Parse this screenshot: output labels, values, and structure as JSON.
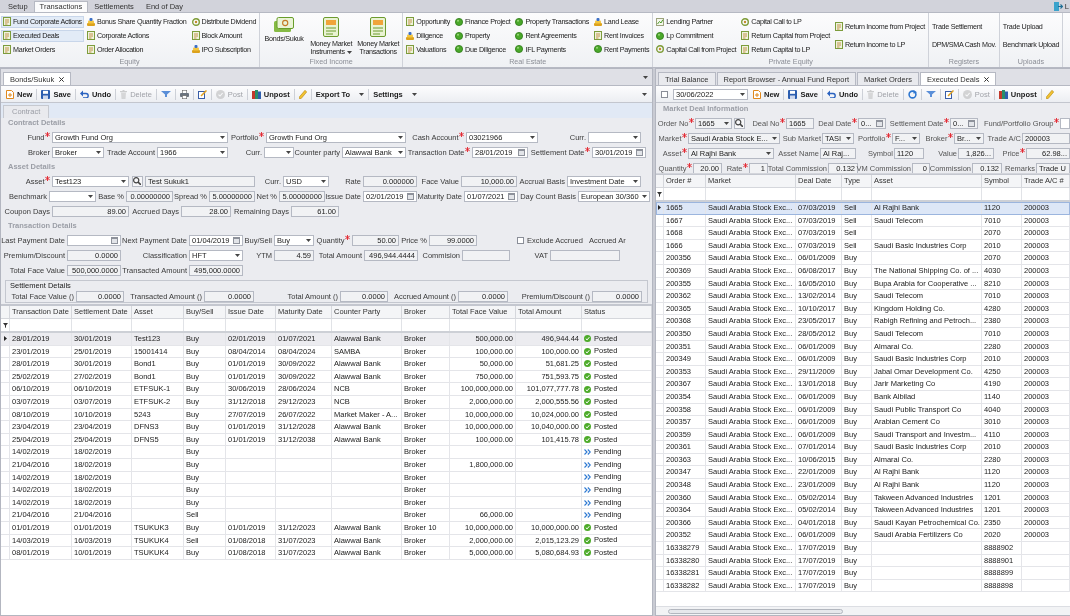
{
  "top_tabs": [
    {
      "label": "Setup",
      "selected": false
    },
    {
      "label": "Transactions",
      "selected": true
    },
    {
      "label": "Settlements",
      "selected": false
    },
    {
      "label": "End of Day",
      "selected": false
    }
  ],
  "logout": {
    "label": "L"
  },
  "ribbon": {
    "groups": [
      {
        "title": "Equity",
        "kind": "small",
        "columns": [
          [
            {
              "label": "Fund Corporate Actions",
              "kind": "doc",
              "highlighted": true
            },
            {
              "label": "Executed Deals",
              "kind": "doc",
              "highlighted": true
            },
            {
              "label": "Market Orders",
              "kind": "doc",
              "highlighted": false
            }
          ],
          [
            {
              "label": "Bonus Share Quantity Fraction",
              "kind": "coin",
              "highlighted": false
            },
            {
              "label": "Corporate Actions",
              "kind": "doc",
              "highlighted": false
            },
            {
              "label": "Order Allocation",
              "kind": "doc",
              "highlighted": false
            }
          ],
          [
            {
              "label": "Distribute Dividend",
              "kind": "ring",
              "highlighted": false
            },
            {
              "label": "Block Amount",
              "kind": "doc",
              "highlighted": false
            },
            {
              "label": "IPO Subscription",
              "kind": "coin",
              "highlighted": false
            }
          ]
        ]
      },
      {
        "title": "Fixed Income",
        "kind": "large",
        "buttons": [
          {
            "label": "Bonds/Sukuk",
            "kind": "cash",
            "dropdown": false
          },
          {
            "label": "Money Market Instruments",
            "kind": "doc",
            "dropdown": true
          },
          {
            "label": "Money Market Transactions",
            "kind": "doc",
            "dropdown": false
          }
        ]
      },
      {
        "title": "Real Estate",
        "kind": "small",
        "columns": [
          [
            {
              "label": "Opportunity",
              "kind": "doc",
              "highlighted": false
            },
            {
              "label": "Diligence",
              "kind": "coin",
              "highlighted": false
            },
            {
              "label": "Valuations",
              "kind": "doc",
              "highlighted": false
            }
          ],
          [
            {
              "label": "Finance Project",
              "kind": "dot",
              "highlighted": false
            },
            {
              "label": "Property",
              "kind": "dot",
              "highlighted": false
            },
            {
              "label": "Due Diligence",
              "kind": "dot",
              "highlighted": false
            }
          ],
          [
            {
              "label": "Property Transactions",
              "kind": "dot",
              "highlighted": false
            },
            {
              "label": "Rent Agreements",
              "kind": "dot",
              "highlighted": false
            },
            {
              "label": "IFL Payments",
              "kind": "dot",
              "highlighted": false
            }
          ],
          [
            {
              "label": "Land Lease",
              "kind": "coin",
              "highlighted": false
            },
            {
              "label": "Rent Invoices",
              "kind": "doc",
              "highlighted": false
            },
            {
              "label": "Rent Payments",
              "kind": "dot",
              "highlighted": false
            }
          ]
        ]
      },
      {
        "title": "Private Equity",
        "kind": "small",
        "columns": [
          [
            {
              "label": "Lending Partner",
              "kind": "chart",
              "highlighted": false
            },
            {
              "label": "Lp Commitment",
              "kind": "dot",
              "highlighted": false
            },
            {
              "label": "Capital Call from Project",
              "kind": "ring",
              "highlighted": false
            }
          ],
          [
            {
              "label": "Capital Call to LP",
              "kind": "ring",
              "highlighted": false
            },
            {
              "label": "Return Capital from Project",
              "kind": "doc",
              "highlighted": false
            },
            {
              "label": "Return Capital to LP",
              "kind": "doc",
              "highlighted": false
            }
          ],
          [
            {
              "label": "Return Income from Project",
              "kind": "doc",
              "highlighted": false
            },
            {
              "label": "Return Income to LP",
              "kind": "doc",
              "highlighted": false
            }
          ]
        ]
      },
      {
        "title": "Registers",
        "kind": "small",
        "columns": [
          [
            {
              "label": "Trade Settlement",
              "kind": "plain",
              "highlighted": false
            },
            {
              "label": "DPM/SMA Cash Mov.",
              "kind": "plain",
              "highlighted": false
            }
          ]
        ]
      },
      {
        "title": "Uploads",
        "kind": "small",
        "columns": [
          [
            {
              "label": "Trade Upload",
              "kind": "plain",
              "highlighted": false
            },
            {
              "label": "Benchmark Upload",
              "kind": "plain",
              "highlighted": false
            }
          ]
        ]
      }
    ]
  },
  "left_pane": {
    "doc_tabs": [
      {
        "label": "Bonds/Sukuk",
        "selected": true,
        "closable": true
      }
    ],
    "toolbar": [
      {
        "kind": "new",
        "label": "New",
        "disabled": false,
        "dropdown": false
      },
      {
        "kind": "save",
        "label": "Save",
        "disabled": false,
        "dropdown": false
      },
      {
        "kind": "undo",
        "label": "Undo",
        "disabled": false,
        "dropdown": false
      },
      {
        "kind": "delete",
        "label": "Delete",
        "disabled": true,
        "dropdown": false
      },
      {
        "kind": "filter",
        "disabled": false,
        "dropdown": false
      },
      {
        "kind": "print",
        "disabled": false,
        "dropdown": false
      },
      {
        "kind": "edit",
        "disabled": false,
        "dropdown": false
      },
      {
        "kind": "post",
        "label": "Post",
        "disabled": true,
        "dropdown": false
      },
      {
        "kind": "unpost",
        "label": "Unpost",
        "disabled": false,
        "dropdown": false
      },
      {
        "kind": "pencil",
        "disabled": false,
        "dropdown": false
      },
      {
        "kind": "export",
        "label": "Export To",
        "disabled": false,
        "dropdown": true
      },
      {
        "kind": "settings",
        "label": "Settings",
        "disabled": false,
        "dropdown": true
      }
    ],
    "sub_tabs": [
      {
        "label": "Contract",
        "selected": true
      }
    ],
    "sections": [
      {
        "title": "Contract Details",
        "fields": [
          {
            "label": "Fund",
            "required": true,
            "kind": "combo",
            "value": "Growth Fund Org",
            "readonly": false
          },
          {
            "label": "Portfolio",
            "required": true,
            "kind": "combo",
            "value": "Growth Fund Org",
            "readonly": false
          },
          {
            "label": "Cash Account",
            "required": true,
            "kind": "combo",
            "value": "03021966",
            "readonly": false
          },
          {
            "label": "Curr.",
            "required": false,
            "kind": "combo",
            "readonly": false
          },
          {
            "label": "Broker",
            "required": false,
            "kind": "combo",
            "value": "Broker",
            "readonly": false
          },
          {
            "label": "Trade Account",
            "required": false,
            "kind": "combo",
            "value": "1966",
            "readonly": false
          },
          {
            "label": "Curr.",
            "required": false,
            "kind": "combo",
            "readonly": false
          },
          {
            "label": "Counter party",
            "required": false,
            "kind": "combo",
            "value": "Alawwal Bank",
            "readonly": false
          },
          {
            "label": "Transaction Date",
            "required": true,
            "kind": "date",
            "value": "28/01/2019",
            "readonly": false
          },
          {
            "label": "Settlement Date",
            "required": true,
            "kind": "date",
            "value": "30/01/2019",
            "readonly": false
          }
        ]
      },
      {
        "title": "Asset Details",
        "fields": [
          {
            "label": "Asset",
            "required": true,
            "kind": "combo",
            "value": "Test123",
            "readonly": false
          },
          {
            "kind": "search"
          },
          {
            "kind": "text",
            "value": "Test Sukuk1",
            "readonly": true
          },
          {
            "label": "Curr.",
            "required": false,
            "kind": "combo",
            "value": "USD",
            "readonly": false
          },
          {
            "label": "Rate",
            "required": false,
            "kind": "number",
            "value": "0.000000",
            "readonly": true
          },
          {
            "label": "Face Value",
            "required": false,
            "kind": "number",
            "value": "10,000.00",
            "readonly": true
          },
          {
            "label": "Accrual Basis",
            "required": false,
            "kind": "combo",
            "value": "Investment Date",
            "readonly": false
          },
          {
            "label": "Benchmark",
            "required": false,
            "kind": "combo",
            "readonly": false
          },
          {
            "label": "Base %",
            "required": false,
            "kind": "number",
            "value": "0.00000000",
            "readonly": true
          },
          {
            "label": "Spread %",
            "required": false,
            "kind": "number",
            "value": "5.00000000",
            "readonly": true
          },
          {
            "label": "Net %",
            "required": false,
            "kind": "number",
            "value": "5.00000000",
            "readonly": true
          },
          {
            "label": "Issue Date",
            "required": false,
            "kind": "date",
            "value": "02/01/2019",
            "readonly": false
          },
          {
            "label": "Maturity Date",
            "required": false,
            "kind": "date",
            "value": "01/07/2021",
            "readonly": false
          },
          {
            "label": "Day Count Basis",
            "required": false,
            "kind": "combo",
            "value": "European 30/360",
            "readonly": false
          },
          {
            "label": "Coupon Days",
            "required": false,
            "kind": "number",
            "value": "89.00",
            "readonly": true
          },
          {
            "label": "Accrued Days",
            "required": false,
            "kind": "number",
            "value": "28.00",
            "readonly": true
          },
          {
            "label": "Remaining Days",
            "required": false,
            "kind": "number",
            "value": "61.00",
            "readonly": true
          }
        ]
      },
      {
        "title": "Transaction Details",
        "fields": [
          {
            "label": "Last Payment Date",
            "required": false,
            "kind": "date",
            "readonly": false
          },
          {
            "label": "Next Payment Date",
            "required": false,
            "kind": "date",
            "value": "01/04/2019",
            "readonly": false
          },
          {
            "label": "Buy/Sell",
            "required": false,
            "kind": "combo",
            "value": "Buy",
            "readonly": false
          },
          {
            "label": "Quantity",
            "required": true,
            "kind": "number",
            "value": "50.00",
            "readonly": true
          },
          {
            "label": "Price %",
            "required": false,
            "kind": "number",
            "value": "99.0000",
            "readonly": true
          },
          {
            "kind": "checkbox",
            "label": "Exclude Accrued",
            "checked": false
          },
          {
            "kind": "label",
            "label": "Accrued Ar"
          },
          {
            "label": "Premium/Discount",
            "required": false,
            "kind": "number",
            "value": "0.0000",
            "readonly": true
          },
          {
            "label": "Classification",
            "required": false,
            "kind": "combo",
            "value": "HFT",
            "readonly": false
          },
          {
            "label": "YTM",
            "required": false,
            "kind": "number",
            "value": "4.59",
            "readonly": true
          },
          {
            "label": "Total Amount",
            "required": false,
            "kind": "number",
            "value": "496,944.4444",
            "readonly": true
          },
          {
            "label": "Commision",
            "required": false,
            "kind": "number",
            "readonly": true
          },
          {
            "label": "VAT",
            "required": false,
            "kind": "number",
            "readonly": true
          },
          {
            "label": "Total Face Value",
            "required": false,
            "kind": "number",
            "value": "500,000.0000",
            "readonly": true
          },
          {
            "label": "Transacted Amount",
            "required": false,
            "kind": "number",
            "value": "495,000.0000",
            "readonly": true
          }
        ]
      }
    ],
    "settlement": {
      "title": "Settlement Details",
      "fields": [
        {
          "label": "Total Face Value ()",
          "required": false,
          "kind": "number",
          "value": "0.0000",
          "readonly": true
        },
        {
          "label": "Transacted Amount ()",
          "required": false,
          "kind": "number",
          "value": "0.0000",
          "readonly": true
        },
        {
          "label": "Total Amount ()",
          "required": false,
          "kind": "number",
          "value": "0.0000",
          "readonly": true
        },
        {
          "label": "Accrued Amount ()",
          "required": false,
          "kind": "number",
          "value": "0.0000",
          "readonly": true
        },
        {
          "label": "Premium/Discount ()",
          "required": false,
          "kind": "number",
          "value": "0.0000",
          "readonly": true
        }
      ]
    },
    "grid": {
      "columns": [
        "Transaction Date",
        "Settlement Date",
        "Asset",
        "Buy/Sell",
        "Issue Date",
        "Maturity Date",
        "Counter Party",
        "Broker",
        "Total Face Value",
        "Total Amount",
        "Status"
      ],
      "rows": [
        {
          "selected": true,
          "transaction_date": "28/01/2019",
          "settlement_date": "30/01/2019",
          "asset": "Test123",
          "buy_sell": "Buy",
          "issue_date": "02/01/2019",
          "maturity_date": "01/07/2021",
          "counter_party": "Alawwal Bank",
          "broker": "Broker",
          "total_face_value": "500,000.00",
          "total_amount": "496,944.44",
          "status": {
            "label": "Posted",
            "kind": "posted"
          }
        },
        {
          "selected": false,
          "transaction_date": "23/01/2019",
          "settlement_date": "25/01/2019",
          "asset": "15001414",
          "buy_sell": "Buy",
          "issue_date": "08/04/2014",
          "maturity_date": "08/04/2024",
          "counter_party": "SAMBA",
          "broker": "Broker",
          "total_face_value": "100,000.00",
          "total_amount": "100,000.00",
          "status": {
            "label": "Posted",
            "kind": "posted"
          }
        },
        {
          "selected": false,
          "transaction_date": "28/01/2019",
          "settlement_date": "30/01/2019",
          "asset": "Bond1",
          "buy_sell": "Buy",
          "issue_date": "01/01/2019",
          "maturity_date": "30/09/2022",
          "counter_party": "Alawwal Bank",
          "broker": "Broker",
          "total_face_value": "50,000.00",
          "total_amount": "51,681.25",
          "status": {
            "label": "Posted",
            "kind": "posted"
          }
        },
        {
          "selected": false,
          "transaction_date": "25/02/2019",
          "settlement_date": "27/02/2019",
          "asset": "Bond1",
          "buy_sell": "Buy",
          "issue_date": "01/01/2019",
          "maturity_date": "30/09/2022",
          "counter_party": "Alawwal Bank",
          "broker": "Broker",
          "total_face_value": "750,000.00",
          "total_amount": "751,593.75",
          "status": {
            "label": "Posted",
            "kind": "posted"
          }
        },
        {
          "selected": false,
          "transaction_date": "06/10/2019",
          "settlement_date": "06/10/2019",
          "asset": "ETFSUK-1",
          "buy_sell": "Buy",
          "issue_date": "30/06/2019",
          "maturity_date": "28/06/2024",
          "counter_party": "NCB",
          "broker": "Broker",
          "total_face_value": "100,000,000.00",
          "total_amount": "101,077,777.78",
          "status": {
            "label": "Posted",
            "kind": "posted"
          }
        },
        {
          "selected": false,
          "transaction_date": "03/07/2019",
          "settlement_date": "03/07/2019",
          "asset": "ETFSUK-2",
          "buy_sell": "Buy",
          "issue_date": "31/12/2018",
          "maturity_date": "29/12/2023",
          "counter_party": "NCB",
          "broker": "Broker",
          "total_face_value": "2,000,000.00",
          "total_amount": "2,000,555.56",
          "status": {
            "label": "Posted",
            "kind": "posted"
          }
        },
        {
          "selected": false,
          "transaction_date": "08/10/2019",
          "settlement_date": "10/10/2019",
          "asset": "5243",
          "buy_sell": "Buy",
          "issue_date": "27/07/2019",
          "maturity_date": "26/07/2022",
          "counter_party": "Market Maker - A...",
          "broker": "Broker",
          "total_face_value": "10,000,000.00",
          "total_amount": "10,024,000.00",
          "status": {
            "label": "Posted",
            "kind": "posted"
          }
        },
        {
          "selected": false,
          "transaction_date": "23/04/2019",
          "settlement_date": "23/04/2019",
          "asset": "DFNS3",
          "buy_sell": "Buy",
          "issue_date": "01/01/2019",
          "maturity_date": "31/12/2028",
          "counter_party": "Alawwal Bank",
          "broker": "Broker",
          "total_face_value": "10,000,000.00",
          "total_amount": "10,040,000.00",
          "status": {
            "label": "Posted",
            "kind": "posted"
          }
        },
        {
          "selected": false,
          "transaction_date": "25/04/2019",
          "settlement_date": "25/04/2019",
          "asset": "DFNS5",
          "buy_sell": "Buy",
          "issue_date": "01/01/2019",
          "maturity_date": "31/12/2038",
          "counter_party": "Alawwal Bank",
          "broker": "Broker",
          "total_face_value": "100,000.00",
          "total_amount": "101,415.78",
          "status": {
            "label": "Posted",
            "kind": "posted"
          }
        },
        {
          "selected": false,
          "transaction_date": "14/02/2019",
          "settlement_date": "18/02/2019",
          "buy_sell": "Buy",
          "broker": "Broker",
          "status": {
            "label": "Pending",
            "kind": "pending"
          }
        },
        {
          "selected": false,
          "transaction_date": "21/04/2016",
          "settlement_date": "18/02/2019",
          "buy_sell": "Buy",
          "broker": "Broker",
          "total_face_value": "1,800,000.00",
          "status": {
            "label": "Pending",
            "kind": "pending"
          }
        },
        {
          "selected": false,
          "transaction_date": "14/02/2019",
          "settlement_date": "18/02/2019",
          "buy_sell": "Buy",
          "broker": "Broker",
          "status": {
            "label": "Pending",
            "kind": "pending"
          }
        },
        {
          "selected": false,
          "transaction_date": "14/02/2019",
          "settlement_date": "18/02/2019",
          "buy_sell": "Buy",
          "broker": "Broker",
          "status": {
            "label": "Pending",
            "kind": "pending"
          }
        },
        {
          "selected": false,
          "transaction_date": "14/02/2019",
          "settlement_date": "18/02/2019",
          "buy_sell": "Buy",
          "broker": "Broker",
          "status": {
            "label": "Pending",
            "kind": "pending"
          }
        },
        {
          "selected": false,
          "transaction_date": "21/04/2016",
          "settlement_date": "21/04/2016",
          "buy_sell": "Sell",
          "broker": "Broker",
          "total_face_value": "66,000.00",
          "status": {
            "label": "Pending",
            "kind": "pending"
          }
        },
        {
          "selected": false,
          "transaction_date": "01/01/2019",
          "settlement_date": "01/01/2019",
          "asset": "TSUKUK3",
          "buy_sell": "Buy",
          "issue_date": "01/01/2019",
          "maturity_date": "31/12/2023",
          "counter_party": "Alawwal Bank",
          "broker": "Broker 10",
          "total_face_value": "10,000,000.00",
          "total_amount": "10,000,000.00",
          "status": {
            "label": "Posted",
            "kind": "posted"
          }
        },
        {
          "selected": false,
          "transaction_date": "14/03/2019",
          "settlement_date": "16/03/2019",
          "asset": "TSUKUK4",
          "buy_sell": "Sell",
          "issue_date": "01/08/2018",
          "maturity_date": "31/07/2023",
          "counter_party": "Alawwal Bank",
          "broker": "Broker",
          "total_face_value": "2,000,000.00",
          "total_amount": "2,015,123.29",
          "status": {
            "label": "Posted",
            "kind": "posted"
          }
        },
        {
          "selected": false,
          "transaction_date": "08/01/2019",
          "settlement_date": "10/01/2019",
          "asset": "TSUKUK4",
          "buy_sell": "Buy",
          "issue_date": "01/08/2018",
          "maturity_date": "31/07/2023",
          "counter_party": "Alawwal Bank",
          "broker": "Broker",
          "total_face_value": "5,000,000.00",
          "total_amount": "5,080,684.93",
          "status": {
            "label": "Posted",
            "kind": "posted"
          }
        }
      ]
    }
  },
  "right_pane": {
    "doc_tabs": [
      {
        "label": "Trial Balance",
        "selected": false,
        "closable": false
      },
      {
        "label": "Report Browser - Annual Fund Report",
        "selected": false,
        "closable": false
      },
      {
        "label": "Market Orders",
        "selected": false,
        "closable": false
      },
      {
        "label": "Executed Deals",
        "selected": true,
        "closable": true
      }
    ],
    "select_all": {
      "checked": false
    },
    "date": {
      "value": "30/06/2022"
    },
    "toolbar": [
      {
        "kind": "new",
        "label": "New",
        "disabled": false
      },
      {
        "kind": "save",
        "label": "Save",
        "disabled": false
      },
      {
        "kind": "undo",
        "label": "Undo",
        "disabled": false
      },
      {
        "kind": "delete",
        "label": "Delete",
        "disabled": true
      },
      {
        "kind": "refresh",
        "disabled": false
      },
      {
        "kind": "filter",
        "disabled": false
      },
      {
        "kind": "edit",
        "disabled": false
      },
      {
        "kind": "post",
        "label": "Post",
        "disabled": true
      },
      {
        "kind": "unpost",
        "label": "Unpost",
        "disabled": false
      },
      {
        "kind": "pencil",
        "disabled": false
      }
    ],
    "form": {
      "title": "Market Deal Information",
      "fields": [
        {
          "label": "Order No",
          "required": true,
          "kind": "combo",
          "value": "1665",
          "readonly": true
        },
        {
          "kind": "search"
        },
        {
          "label": "Deal No",
          "required": true,
          "kind": "text",
          "value": "1665",
          "readonly": true
        },
        {
          "label": "Deal Date",
          "required": true,
          "kind": "date",
          "value": "0...",
          "readonly": true
        },
        {
          "label": "Settlement Date",
          "required": true,
          "kind": "date",
          "value": "0...",
          "readonly": true
        },
        {
          "label": "Fund/Portfolio Group",
          "required": true,
          "kind": "text",
          "readonly": false
        },
        {
          "label": "Market",
          "required": true,
          "kind": "combo",
          "value": "Saudi Arabia Stock E...",
          "readonly": true
        },
        {
          "label": "Sub Market",
          "required": false,
          "kind": "combo",
          "value": "TASI",
          "readonly": true
        },
        {
          "label": "Portfolio",
          "required": true,
          "kind": "combo",
          "value": "F...",
          "readonly": true
        },
        {
          "label": "Broker",
          "required": true,
          "kind": "combo",
          "value": "Br...",
          "readonly": true
        },
        {
          "label": "Trade A/C",
          "required": false,
          "kind": "text",
          "value": "200003",
          "readonly": true
        },
        {
          "label": "Asset",
          "required": true,
          "kind": "combo",
          "value": "Al Rajhi Bank",
          "readonly": true
        },
        {
          "label": "Asset Name",
          "required": false,
          "kind": "text",
          "value": "Al Raj...",
          "readonly": true
        },
        {
          "label": "Symbol",
          "required": false,
          "kind": "text",
          "value": "1120",
          "readonly": true
        },
        {
          "label": "Value",
          "required": false,
          "kind": "number",
          "value": "1,826...",
          "readonly": true
        },
        {
          "label": "Price",
          "required": true,
          "kind": "number",
          "value": "62.98...",
          "readonly": true
        },
        {
          "label": "Quantity",
          "required": true,
          "kind": "number",
          "value": "20.00",
          "readonly": true
        },
        {
          "label": "Rate",
          "required": true,
          "kind": "number",
          "value": "1",
          "readonly": true
        },
        {
          "label": "Total Commission",
          "required": false,
          "kind": "number",
          "value": "0.132",
          "readonly": true
        },
        {
          "label": "VM Commission",
          "required": false,
          "kind": "number",
          "value": "0",
          "readonly": true
        },
        {
          "label": "Commission",
          "required": false,
          "kind": "number",
          "value": "0.132",
          "readonly": true
        },
        {
          "label": "Remarks",
          "required": false,
          "kind": "text",
          "value": "Trade U",
          "readonly": true
        }
      ]
    },
    "grid": {
      "columns": [
        "Order #",
        "Market",
        "Deal Date",
        "Type",
        "Asset",
        "Symbol",
        "Trade A/C #"
      ],
      "rows": [
        {
          "selected": true,
          "order_no": "1665",
          "market": "Saudi Arabia Stock Exc...",
          "deal_date": "07/03/2019",
          "type": "Sell",
          "asset": "Al Rajhi Bank",
          "symbol": "1120",
          "trade_account": "200003"
        },
        {
          "selected": false,
          "order_no": "1667",
          "market": "Saudi Arabia Stock Exc...",
          "deal_date": "07/03/2019",
          "type": "Sell",
          "asset": "Saudi Telecom",
          "symbol": "7010",
          "trade_account": "200003"
        },
        {
          "selected": false,
          "order_no": "1668",
          "market": "Saudi Arabia Stock Exc...",
          "deal_date": "07/03/2019",
          "type": "Sell",
          "symbol": "2070",
          "trade_account": "200003"
        },
        {
          "selected": false,
          "order_no": "1666",
          "market": "Saudi Arabia Stock Exc...",
          "deal_date": "07/03/2019",
          "type": "Sell",
          "asset": "Saudi Basic Industries Corp",
          "symbol": "2010",
          "trade_account": "200003"
        },
        {
          "selected": false,
          "order_no": "200356",
          "market": "Saudi Arabia Stock Exc...",
          "deal_date": "06/01/2009",
          "type": "Buy",
          "symbol": "2070",
          "trade_account": "200003"
        },
        {
          "selected": false,
          "order_no": "200369",
          "market": "Saudi Arabia Stock Exc...",
          "deal_date": "06/08/2017",
          "type": "Buy",
          "asset": "The National Shipping Co. of ...",
          "symbol": "4030",
          "trade_account": "200003"
        },
        {
          "selected": false,
          "order_no": "200355",
          "market": "Saudi Arabia Stock Exc...",
          "deal_date": "16/05/2010",
          "type": "Buy",
          "asset": "Bupa Arabia for Cooperative ...",
          "symbol": "8210",
          "trade_account": "200003"
        },
        {
          "selected": false,
          "order_no": "200362",
          "market": "Saudi Arabia Stock Exc...",
          "deal_date": "13/02/2014",
          "type": "Buy",
          "asset": "Saudi Telecom",
          "symbol": "7010",
          "trade_account": "200003"
        },
        {
          "selected": false,
          "order_no": "200365",
          "market": "Saudi Arabia Stock Exc...",
          "deal_date": "10/10/2017",
          "type": "Buy",
          "asset": "Kingdom Holding Co.",
          "symbol": "4280",
          "trade_account": "200003"
        },
        {
          "selected": false,
          "order_no": "200368",
          "market": "Saudi Arabia Stock Exc...",
          "deal_date": "23/05/2017",
          "type": "Buy",
          "asset": "Rabigh Refining and Petroch...",
          "symbol": "2380",
          "trade_account": "200003"
        },
        {
          "selected": false,
          "order_no": "200350",
          "market": "Saudi Arabia Stock Exc...",
          "deal_date": "28/05/2012",
          "type": "Buy",
          "asset": "Saudi Telecom",
          "symbol": "7010",
          "trade_account": "200003"
        },
        {
          "selected": false,
          "order_no": "200351",
          "market": "Saudi Arabia Stock Exc...",
          "deal_date": "06/01/2009",
          "type": "Buy",
          "asset": "Almarai Co.",
          "symbol": "2280",
          "trade_account": "200003"
        },
        {
          "selected": false,
          "order_no": "200349",
          "market": "Saudi Arabia Stock Exc...",
          "deal_date": "06/01/2009",
          "type": "Buy",
          "asset": "Saudi Basic Industries Corp",
          "symbol": "2010",
          "trade_account": "200003"
        },
        {
          "selected": false,
          "order_no": "200353",
          "market": "Saudi Arabia Stock Exc...",
          "deal_date": "29/11/2009",
          "type": "Buy",
          "asset": "Jabal Omar Development Co.",
          "symbol": "4250",
          "trade_account": "200003"
        },
        {
          "selected": false,
          "order_no": "200367",
          "market": "Saudi Arabia Stock Exc...",
          "deal_date": "13/01/2018",
          "type": "Buy",
          "asset": "Jarir Marketing Co",
          "symbol": "4190",
          "trade_account": "200003"
        },
        {
          "selected": false,
          "order_no": "200354",
          "market": "Saudi Arabia Stock Exc...",
          "deal_date": "06/01/2009",
          "type": "Buy",
          "asset": "Bank Albilad",
          "symbol": "1140",
          "trade_account": "200003"
        },
        {
          "selected": false,
          "order_no": "200358",
          "market": "Saudi Arabia Stock Exc...",
          "deal_date": "06/01/2009",
          "type": "Buy",
          "asset": "Saudi Public Transport Co",
          "symbol": "4040",
          "trade_account": "200003"
        },
        {
          "selected": false,
          "order_no": "200357",
          "market": "Saudi Arabia Stock Exc...",
          "deal_date": "06/01/2009",
          "type": "Buy",
          "asset": "Arabian Cement Co",
          "symbol": "3010",
          "trade_account": "200003"
        },
        {
          "selected": false,
          "order_no": "200359",
          "market": "Saudi Arabia Stock Exc...",
          "deal_date": "06/01/2009",
          "type": "Buy",
          "asset": "Saudi Transport and Investm...",
          "symbol": "4110",
          "trade_account": "200003"
        },
        {
          "selected": false,
          "order_no": "200361",
          "market": "Saudi Arabia Stock Exc...",
          "deal_date": "07/01/2014",
          "type": "Buy",
          "asset": "Saudi Basic Industries Corp",
          "symbol": "2010",
          "trade_account": "200003"
        },
        {
          "selected": false,
          "order_no": "200363",
          "market": "Saudi Arabia Stock Exc...",
          "deal_date": "10/06/2015",
          "type": "Buy",
          "asset": "Almarai Co.",
          "symbol": "2280",
          "trade_account": "200003"
        },
        {
          "selected": false,
          "order_no": "200347",
          "market": "Saudi Arabia Stock Exc...",
          "deal_date": "22/01/2009",
          "type": "Buy",
          "asset": "Al Rajhi Bank",
          "symbol": "1120",
          "trade_account": "200003"
        },
        {
          "selected": false,
          "order_no": "200348",
          "market": "Saudi Arabia Stock Exc...",
          "deal_date": "23/01/2009",
          "type": "Buy",
          "asset": "Al Rajhi Bank",
          "symbol": "1120",
          "trade_account": "200003"
        },
        {
          "selected": false,
          "order_no": "200360",
          "market": "Saudi Arabia Stock Exc...",
          "deal_date": "05/02/2014",
          "type": "Buy",
          "asset": "Takween Advanced Industries",
          "symbol": "1201",
          "trade_account": "200003"
        },
        {
          "selected": false,
          "order_no": "200364",
          "market": "Saudi Arabia Stock Exc...",
          "deal_date": "05/02/2014",
          "type": "Buy",
          "asset": "Takween Advanced Industries",
          "symbol": "1201",
          "trade_account": "200003"
        },
        {
          "selected": false,
          "order_no": "200366",
          "market": "Saudi Arabia Stock Exc...",
          "deal_date": "04/01/2018",
          "type": "Buy",
          "asset": "Saudi Kayan Petrochemical Co.",
          "symbol": "2350",
          "trade_account": "200003"
        },
        {
          "selected": false,
          "order_no": "200352",
          "market": "Saudi Arabia Stock Exc...",
          "deal_date": "06/01/2009",
          "type": "Buy",
          "asset": "Saudi Arabia Fertilizers Co",
          "symbol": "2020",
          "trade_account": "200003"
        },
        {
          "selected": false,
          "order_no": "16338279",
          "market": "Saudi Arabia Stock Exc...",
          "deal_date": "17/07/2019",
          "type": "Buy",
          "symbol": "8888902"
        },
        {
          "selected": false,
          "order_no": "16338280",
          "market": "Saudi Arabia Stock Exc...",
          "deal_date": "17/07/2019",
          "type": "Buy",
          "symbol": "8888901"
        },
        {
          "selected": false,
          "order_no": "16338281",
          "market": "Saudi Arabia Stock Exc...",
          "deal_date": "17/07/2019",
          "type": "Buy",
          "symbol": "8888899"
        },
        {
          "selected": false,
          "order_no": "16338282",
          "market": "Saudi Arabia Stock Exc...",
          "deal_date": "17/07/2019",
          "type": "Buy",
          "symbol": "8888898"
        }
      ]
    }
  }
}
